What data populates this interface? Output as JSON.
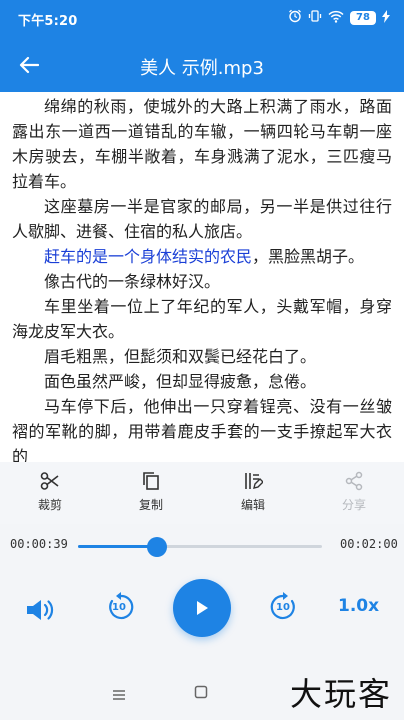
{
  "status_bar": {
    "time": "下午5:20",
    "battery": "78",
    "icons": [
      "alarm-icon",
      "vibrate-icon",
      "wifi-icon",
      "battery-icon",
      "charging-icon"
    ]
  },
  "app_bar": {
    "title": "美人 示例.mp3",
    "back_icon": "arrow-left-icon"
  },
  "content": {
    "paragraphs": [
      "绵绵的秋雨，使城外的大路上积满了雨水，路面露出东一道西一道错乱的车辙，一辆四轮马车朝一座木房驶去，车棚半敞着，车身溅满了泥水，三匹瘦马拉着车。",
      "这座墓房一半是官家的邮局，另一半是供过往行人歇脚、进餐、住宿的私人旅店。",
      "，黑脸黑胡子。",
      "像古代的一条绿林好汉。",
      "车里坐着一位上了年纪的军人，头戴军帽，身穿海龙皮军大衣。",
      "眉毛粗黑，但髭须和双鬓已经花白了。",
      "面色虽然严峻，但却显得疲惫，怠倦。",
      "马车停下后，他伸出一只穿着锃亮、没有一丝皱褶的军靴的脚，用带着鹿皮手套的一支手撩起军大衣的"
    ],
    "highlighted": "赶车的是一个身体结实的农民"
  },
  "toolbar": {
    "cut": "裁剪",
    "copy": "复制",
    "edit": "编辑",
    "share": "分享"
  },
  "player": {
    "current_time": "00:00:39",
    "total_time": "00:02:00",
    "progress": 0.325,
    "rewind_seconds": "10",
    "forward_seconds": "10",
    "speed": "1.0x"
  },
  "watermark": "大玩客",
  "colors": {
    "accent": "#1e83e4",
    "highlight_text": "#1a3fd6",
    "disabled": "#b5b8bd"
  }
}
